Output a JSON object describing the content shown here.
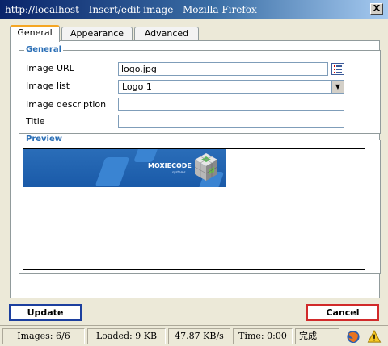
{
  "window": {
    "title": "http://localhost - Insert/edit image - Mozilla Firefox",
    "close_label": "X"
  },
  "tabs": [
    {
      "label": "General",
      "active": true
    },
    {
      "label": "Appearance",
      "active": false
    },
    {
      "label": "Advanced",
      "active": false
    }
  ],
  "general": {
    "legend": "General",
    "image_url_label": "Image URL",
    "image_url_value": "logo.jpg",
    "image_list_label": "Image list",
    "image_list_value": "Logo 1",
    "image_description_label": "Image description",
    "image_description_value": "",
    "title_label": "Title",
    "title_value": ""
  },
  "preview": {
    "legend": "Preview",
    "logo_text": "MOXIECODE",
    "logo_subtext": "systems"
  },
  "buttons": {
    "update_label": "Update",
    "cancel_label": "Cancel"
  },
  "statusbar": {
    "images": "Images: 6/6",
    "loaded": "Loaded: 9 KB",
    "speed": "47.87 KB/s",
    "time": "Time: 0:00",
    "status": "完成"
  },
  "icons": {
    "browse": "browse-icon",
    "firefox": "firefox-icon",
    "warning": "warning-icon"
  },
  "colors": {
    "legend": "#2b6fb6",
    "active_tab_accent": "#f5a623",
    "update_border": "#1c3f9e",
    "cancel_border": "#d12a2a"
  }
}
